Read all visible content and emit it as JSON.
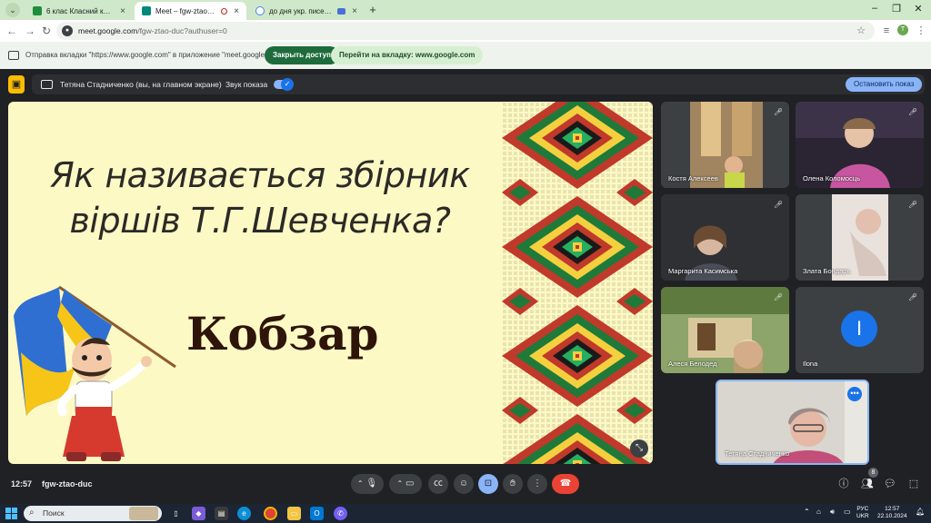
{
  "browser": {
    "tabs": [
      {
        "title": "6 клас Класний керівник: Кузь"
      },
      {
        "title": "Meet – fgw-ztao-duc"
      },
      {
        "title": "до дня укр. писемності та"
      }
    ],
    "url_main": "meet.google.com",
    "url_rest": "/fgw-ztao-duc?authuser=0",
    "profile_initial": "Т"
  },
  "infobar": {
    "message": "Отправка вкладки \"https://www.google.com\" в приложение \"meet.google.com\"...",
    "stop_label": "Закрыть доступ",
    "switch_label": "Перейти на вкладку: www.google.com"
  },
  "sharebar": {
    "presenter": "Тетяна Стадниченко (вы, на главном экране)",
    "sound_label": "Звук показа",
    "stop_label": "Остановить показ"
  },
  "slide": {
    "question_line1": "Як називається збірник",
    "question_line2": "віршів Т.Г.Шевченка?",
    "answer": "Кобзар"
  },
  "participants": [
    {
      "name": "Костя Алексеев"
    },
    {
      "name": "Олена Коломосць"
    },
    {
      "name": "Маргарита Касимська"
    },
    {
      "name": "Злата Бондарь"
    },
    {
      "name": "Алеся Белодед"
    },
    {
      "name": "Ilona",
      "initial": "I"
    },
    {
      "name": "Тетяна Стадниченко"
    }
  ],
  "meeting": {
    "time": "12:57",
    "code": "fgw-ztao-duc",
    "people_count": "8"
  },
  "taskbar": {
    "search_placeholder": "Поиск",
    "lang_line1": "РУС",
    "lang_line2": "UKR",
    "clock_time": "12:57",
    "clock_date": "22.10.2024"
  },
  "colors": {
    "tab_strip": "#cfe8c9",
    "slide_bg": "#fdf9c4",
    "meet_bg": "#202124",
    "accent_blue": "#8ab4f8",
    "end_call_red": "#ea4335",
    "present_yellow": "#fbbc04"
  }
}
